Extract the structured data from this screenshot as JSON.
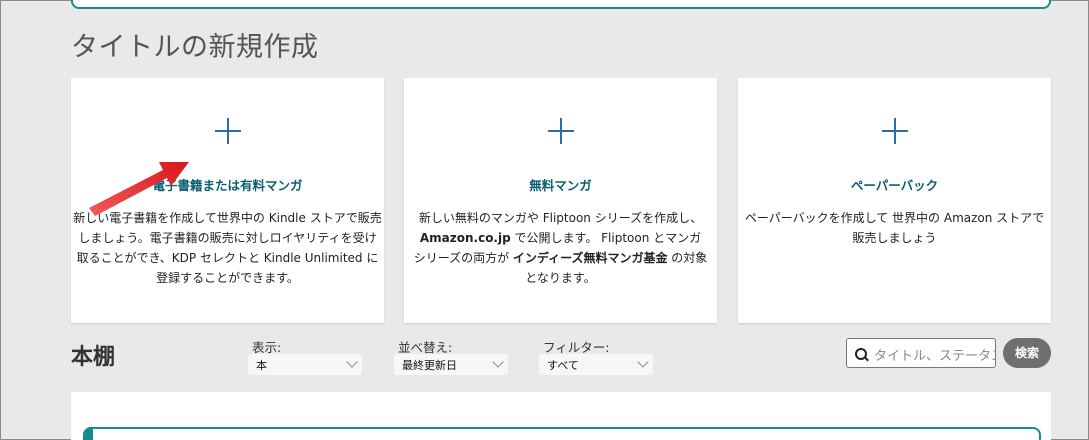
{
  "page_title": "タイトルの新規作成",
  "cards": [
    {
      "title": "電子書籍または有料マンガ",
      "description_html": "新しい電子書籍を作成して世界中の Kindle ストアで販売しましょう。電子書籍の販売に対しロイヤリティを受け取ることができ、KDP セレクトと Kindle Unlimited に登録することができます。"
    },
    {
      "title": "無料マンガ",
      "desc_part1": "新しい無料のマンガや Fliptoon シリーズを作成し、",
      "desc_bold1": "Amazon.co.jp",
      "desc_part2": " で公開します。 Fliptoon とマンガ シリーズの両方が ",
      "desc_bold2": "インディーズ無料マンガ基金",
      "desc_part3": " の対象となります。"
    },
    {
      "title": "ペーパーバック",
      "description_html": "ペーパーバックを作成して 世界中の Amazon ストアで販売しましょう"
    }
  ],
  "shelf": {
    "title": "本棚",
    "display_label": "表示:",
    "display_value": "本",
    "sort_label": "並べ替え:",
    "sort_value": "最終更新日",
    "filter_label": "フィルター:",
    "filter_value": "すべて",
    "search_placeholder": "タイトル、ステータス",
    "search_button": "検索"
  },
  "colors": {
    "accent_teal": "#1a8a91",
    "card_title": "#0b5e73",
    "plus_blue": "#2a6fa8",
    "arrow_red": "#e8262a"
  }
}
